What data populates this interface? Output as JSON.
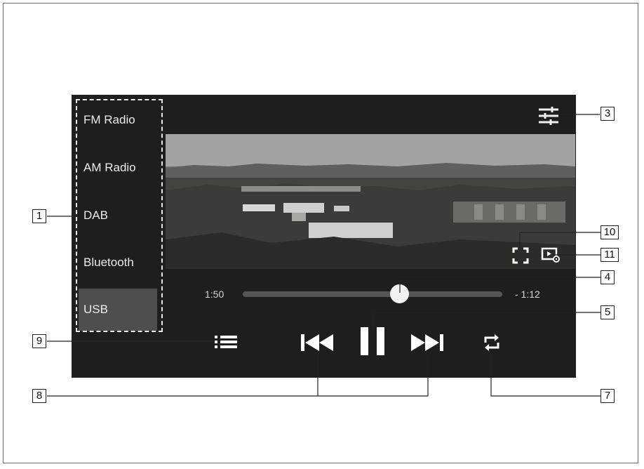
{
  "sources": [
    {
      "label": "FM Radio",
      "active": false
    },
    {
      "label": "AM Radio",
      "active": false
    },
    {
      "label": "DAB",
      "active": false
    },
    {
      "label": "Bluetooth",
      "active": false
    },
    {
      "label": "USB",
      "active": true
    }
  ],
  "player": {
    "elapsed": "1:50",
    "remaining": "- 1:12",
    "progress": 0.61,
    "state": "playing"
  },
  "icons": {
    "settings": "sliders-icon",
    "fullscreen": "fullscreen-icon",
    "video_settings": "video-settings-icon",
    "playlist": "playlist-icon",
    "previous": "skip-previous-icon",
    "pause": "pause-icon",
    "next": "skip-next-icon",
    "repeat": "repeat-icon"
  },
  "callouts": {
    "c1": "1",
    "c3": "3",
    "c4": "4",
    "c5": "5",
    "c7": "7",
    "c8": "8",
    "c9": "9",
    "c10": "10",
    "c11": "11"
  }
}
